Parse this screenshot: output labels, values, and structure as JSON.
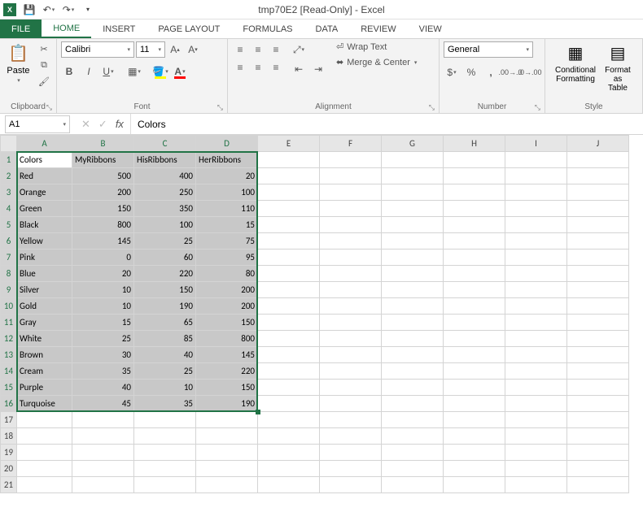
{
  "title": "tmp70E2  [Read-Only] - Excel",
  "tabs": {
    "file": "FILE",
    "home": "HOME",
    "insert": "INSERT",
    "page_layout": "PAGE LAYOUT",
    "formulas": "FORMULAS",
    "data": "DATA",
    "review": "REVIEW",
    "view": "VIEW"
  },
  "ribbon": {
    "clipboard": {
      "label": "Clipboard",
      "paste": "Paste"
    },
    "font": {
      "label": "Font",
      "name": "Calibri",
      "size": "11"
    },
    "alignment": {
      "label": "Alignment",
      "wrap": "Wrap Text",
      "merge": "Merge & Center"
    },
    "number": {
      "label": "Number",
      "format": "General"
    },
    "styles": {
      "label": "Style",
      "cond": "Conditional Formatting",
      "fmt": "Format as Table"
    }
  },
  "namebox": "A1",
  "formula": "Colors",
  "columns": [
    "A",
    "B",
    "C",
    "D",
    "E",
    "F",
    "G",
    "H",
    "I",
    "J"
  ],
  "sel_cols": 4,
  "sel_rows": 16,
  "total_rows": 21,
  "headers": [
    "Colors",
    "MyRibbons",
    "HisRibbons",
    "HerRibbons"
  ],
  "rows": [
    [
      "Red",
      "500",
      "400",
      "20"
    ],
    [
      "Orange",
      "200",
      "250",
      "100"
    ],
    [
      "Green",
      "150",
      "350",
      "110"
    ],
    [
      "Black",
      "800",
      "100",
      "15"
    ],
    [
      "Yellow",
      "145",
      "25",
      "75"
    ],
    [
      "Pink",
      "0",
      "60",
      "95"
    ],
    [
      "Blue",
      "20",
      "220",
      "80"
    ],
    [
      "Silver",
      "10",
      "150",
      "200"
    ],
    [
      "Gold",
      "10",
      "190",
      "200"
    ],
    [
      "Gray",
      "15",
      "65",
      "150"
    ],
    [
      "White",
      "25",
      "85",
      "800"
    ],
    [
      "Brown",
      "30",
      "40",
      "145"
    ],
    [
      "Cream",
      "35",
      "25",
      "220"
    ],
    [
      "Purple",
      "40",
      "10",
      "150"
    ],
    [
      "Turquoise",
      "45",
      "35",
      "190"
    ]
  ],
  "chart_data": {
    "type": "table",
    "title": "",
    "columns": [
      "Colors",
      "MyRibbons",
      "HisRibbons",
      "HerRibbons"
    ],
    "data": [
      {
        "Colors": "Red",
        "MyRibbons": 500,
        "HisRibbons": 400,
        "HerRibbons": 20
      },
      {
        "Colors": "Orange",
        "MyRibbons": 200,
        "HisRibbons": 250,
        "HerRibbons": 100
      },
      {
        "Colors": "Green",
        "MyRibbons": 150,
        "HisRibbons": 350,
        "HerRibbons": 110
      },
      {
        "Colors": "Black",
        "MyRibbons": 800,
        "HisRibbons": 100,
        "HerRibbons": 15
      },
      {
        "Colors": "Yellow",
        "MyRibbons": 145,
        "HisRibbons": 25,
        "HerRibbons": 75
      },
      {
        "Colors": "Pink",
        "MyRibbons": 0,
        "HisRibbons": 60,
        "HerRibbons": 95
      },
      {
        "Colors": "Blue",
        "MyRibbons": 20,
        "HisRibbons": 220,
        "HerRibbons": 80
      },
      {
        "Colors": "Silver",
        "MyRibbons": 10,
        "HisRibbons": 150,
        "HerRibbons": 200
      },
      {
        "Colors": "Gold",
        "MyRibbons": 10,
        "HisRibbons": 190,
        "HerRibbons": 200
      },
      {
        "Colors": "Gray",
        "MyRibbons": 15,
        "HisRibbons": 65,
        "HerRibbons": 150
      },
      {
        "Colors": "White",
        "MyRibbons": 25,
        "HisRibbons": 85,
        "HerRibbons": 800
      },
      {
        "Colors": "Brown",
        "MyRibbons": 30,
        "HisRibbons": 40,
        "HerRibbons": 145
      },
      {
        "Colors": "Cream",
        "MyRibbons": 35,
        "HisRibbons": 25,
        "HerRibbons": 220
      },
      {
        "Colors": "Purple",
        "MyRibbons": 40,
        "HisRibbons": 10,
        "HerRibbons": 150
      },
      {
        "Colors": "Turquoise",
        "MyRibbons": 45,
        "HisRibbons": 35,
        "HerRibbons": 190
      }
    ]
  }
}
